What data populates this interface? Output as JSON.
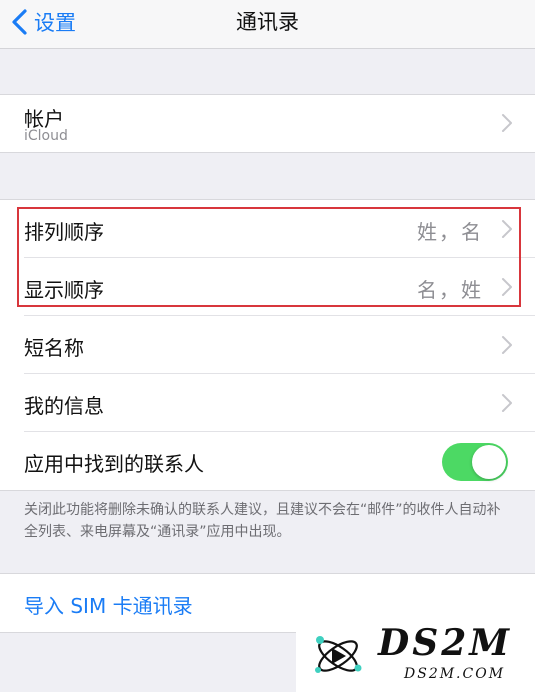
{
  "navbar": {
    "back_label": "设置",
    "title": "通讯录"
  },
  "account": {
    "title": "帐户",
    "subtitle": "iCloud"
  },
  "settings": {
    "sort_order": {
      "label": "排列顺序",
      "value": "姓，名"
    },
    "display_order": {
      "label": "显示顺序",
      "value": "名，姓"
    },
    "short_name": {
      "label": "短名称"
    },
    "my_info": {
      "label": "我的信息"
    },
    "found_in_apps": {
      "label": "应用中找到的联系人",
      "enabled": true
    }
  },
  "footnote": "关闭此功能将删除未确认的联系人建议，且建议不会在“邮件”的收件人自动补全列表、来电屏幕及“通讯录”应用中出现。",
  "import": {
    "label": "导入 SIM 卡通讯录"
  },
  "watermark": {
    "brand": "DS2M",
    "domain": "DS2M.COM"
  },
  "colors": {
    "accent": "#1a7cf5",
    "toggle_on": "#4cd964",
    "highlight_border": "#d8363c",
    "background": "#efeff4"
  },
  "icons": {
    "back": "chevron-left-icon",
    "disclosure": "chevron-right-icon"
  }
}
